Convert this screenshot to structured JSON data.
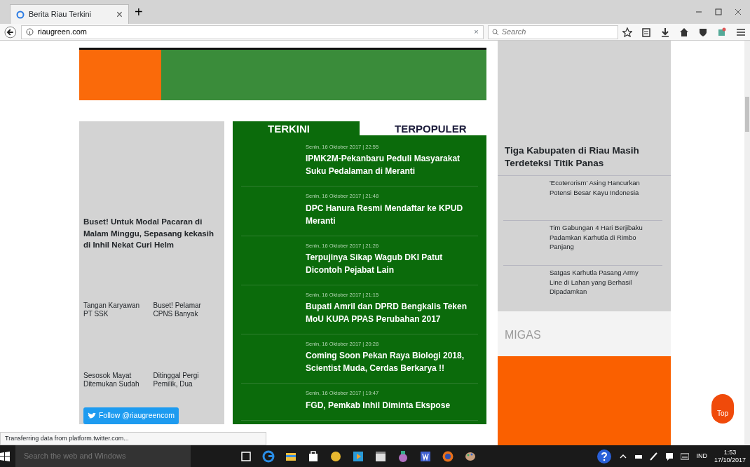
{
  "browser": {
    "tabs": [
      {
        "title": "Berita Riau Terkini",
        "selected": true
      }
    ],
    "close_tab": "×",
    "new_tab": "+",
    "address": "riaugreen.com",
    "clear": "×",
    "search": {
      "placeholder": "Search"
    }
  },
  "left_column": {
    "headline": "Buset! Untuk Modal Pacaran di Malam Minggu, Sepasang kekasih di Inhil Nekat Curi Helm",
    "items": [
      {
        "text": "Tangan Karyawan PT SSK"
      },
      {
        "text": "Buset! Pelamar CPNS Banyak"
      },
      {
        "text": "Sesosok Mayat Ditemukan Sudah"
      },
      {
        "text": "Ditinggal Pergi Pemilik, Dua"
      }
    ],
    "follow_button": "Follow @riaugreencom"
  },
  "news_tabs": [
    {
      "label": "TERKINI",
      "selected": true
    },
    {
      "label": "TERPOPULER",
      "selected": false
    }
  ],
  "news": [
    {
      "date": "Senin, 16 Oktober 2017 | 22:55",
      "title": "IPMK2M-Pekanbaru Peduli Masyarakat Suku Pedalaman di Meranti"
    },
    {
      "date": "Senin, 16 Oktober 2017 | 21:48",
      "title": "DPC Hanura Resmi Mendaftar ke KPUD Meranti"
    },
    {
      "date": "Senin, 16 Oktober 2017 | 21:26",
      "title": "Terpujinya Sikap Wagub DKI Patut Dicontoh Pejabat Lain"
    },
    {
      "date": "Senin, 16 Oktober 2017 | 21:15",
      "title": "Bupati Amril dan DPRD Bengkalis Teken MoU KUPA PPAS Perubahan 2017"
    },
    {
      "date": "Senin, 16 Oktober 2017 | 20:28",
      "title": "Coming Soon Pekan Raya Biologi 2018, Scientist Muda, Cerdas Berkarya !!"
    },
    {
      "date": "Senin, 16 Oktober 2017 | 19:47",
      "title": "FGD, Pemkab Inhil Diminta Ekspose"
    }
  ],
  "right_column": {
    "headline": "Tiga Kabupaten di Riau Masih Terdeteksi Titik Panas",
    "items": [
      {
        "text": "'Ecoterorism' Asing Hancurkan Potensi Besar Kayu Indonesia"
      },
      {
        "text": "Tim Gabungan 4 Hari Berjibaku Padamkan Karhutla di Rimbo Panjang"
      },
      {
        "text": "Satgas Karhutla Pasang Army Line di Lahan yang Berhasil Dipadamkan"
      }
    ],
    "section_title": "MIGAS"
  },
  "top_button": "Top",
  "status_text": "Transferring data from platform.twitter.com...",
  "taskbar": {
    "search": {
      "placeholder": "Search the web and Windows"
    },
    "language": "IND",
    "time": "1:53",
    "date": "17/10/2017"
  }
}
